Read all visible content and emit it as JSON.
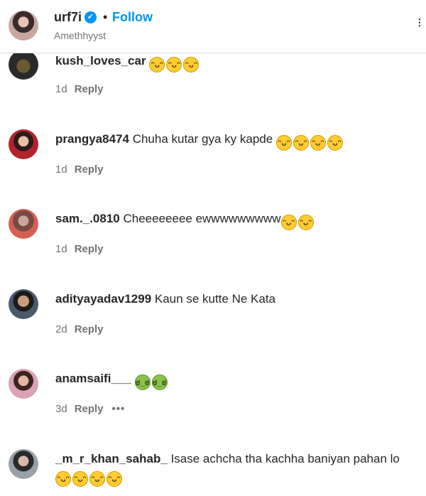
{
  "header": {
    "username": "urf7i",
    "dot": "•",
    "follow_label": "Follow",
    "subtitle": "Amethhyyst",
    "more_glyph": "⁝"
  },
  "comments": [
    {
      "user": "kush_loves_car",
      "text": "",
      "emojis": [
        "laugh",
        "laugh",
        "laugh"
      ],
      "age": "1d",
      "reply": "Reply"
    },
    {
      "user": "prangya8474",
      "text": "Chuha kutar gya ky kapde",
      "emojis": [
        "laugh",
        "laugh",
        "laugh",
        "laugh"
      ],
      "age": "1d",
      "reply": "Reply"
    },
    {
      "user": "sam._.0810",
      "text": "Cheeeeeeee ewwwwwwwww",
      "emojis": [
        "laugh",
        "laugh"
      ],
      "age": "1d",
      "reply": "Reply"
    },
    {
      "user": "adityayadav1299",
      "text": "Kaun se kutte Ne Kata",
      "emojis": [],
      "age": "2d",
      "reply": "Reply"
    },
    {
      "user": "anamsaifi___",
      "text": "",
      "emojis": [
        "sick",
        "sick"
      ],
      "age": "3d",
      "reply": "Reply",
      "more": "•••"
    },
    {
      "user": "_m_r_khan_sahab_",
      "text": "Isase achcha tha kachha baniyan pahan lo",
      "emojis": [
        "laugh",
        "laugh",
        "laugh",
        "laugh"
      ],
      "age": "",
      "reply": ""
    }
  ],
  "emoji_glyphs": {
    "laugh": "ᵔᴗᵔ",
    "sick": "ಠ_ಠ"
  }
}
